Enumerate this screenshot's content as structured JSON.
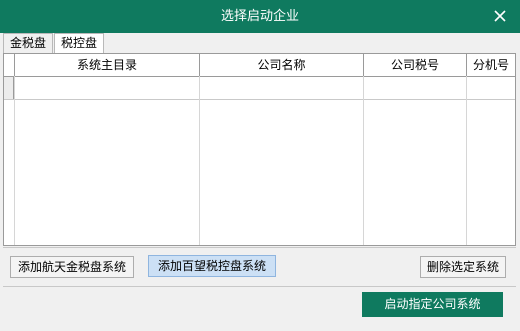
{
  "window": {
    "title": "选择启动企业"
  },
  "tabs": [
    {
      "label": "金税盘",
      "active": false
    },
    {
      "label": "税控盘",
      "active": true
    }
  ],
  "table": {
    "columns": [
      "系统主目录",
      "公司名称",
      "公司税号",
      "分机号"
    ],
    "rows": []
  },
  "buttons": {
    "add_golden_tax": "添加航天金税盘系统",
    "add_baiwang": "添加百望税控盘系统",
    "delete_selected": "删除选定系统",
    "start_company": "启动指定公司系统"
  },
  "colors": {
    "accent": "#0f7a5f"
  }
}
